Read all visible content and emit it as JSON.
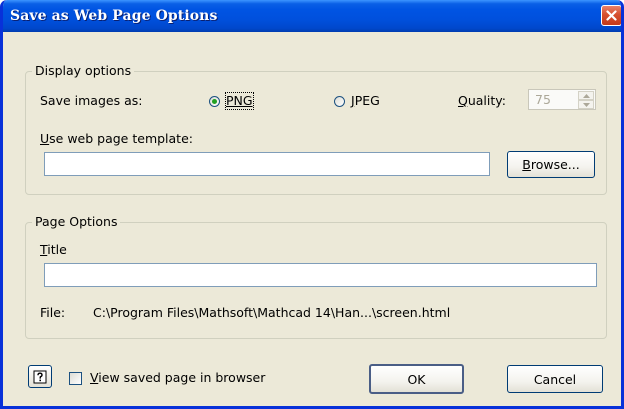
{
  "window": {
    "title": "Save as Web Page Options"
  },
  "display_options": {
    "legend": "Display options",
    "save_images_label": "Save images as:",
    "png_label": "PNG",
    "png_selected": true,
    "jpeg_label": "JPEG",
    "jpeg_selected": false,
    "quality_label": "Quality:",
    "quality_value": "75",
    "template_label": "Use web page template:",
    "template_value": "",
    "browse_label": "Browse..."
  },
  "page_options": {
    "legend": "Page Options",
    "title_label": "Title",
    "title_value": "",
    "file_label": "File:",
    "file_path": "C:\\Program Files\\Mathsoft\\Mathcad 14\\Han...\\screen.html"
  },
  "footer": {
    "help_icon": "question-mark-icon",
    "view_in_browser_label": "View saved page in browser",
    "view_in_browser_checked": false,
    "ok_label": "OK",
    "cancel_label": "Cancel"
  },
  "colors": {
    "titlebar": "#0054e3",
    "window_border": "#0831d9",
    "dialog_bg": "#ece9d8",
    "close_button": "#d6502f",
    "radio_dot": "#21a121"
  }
}
